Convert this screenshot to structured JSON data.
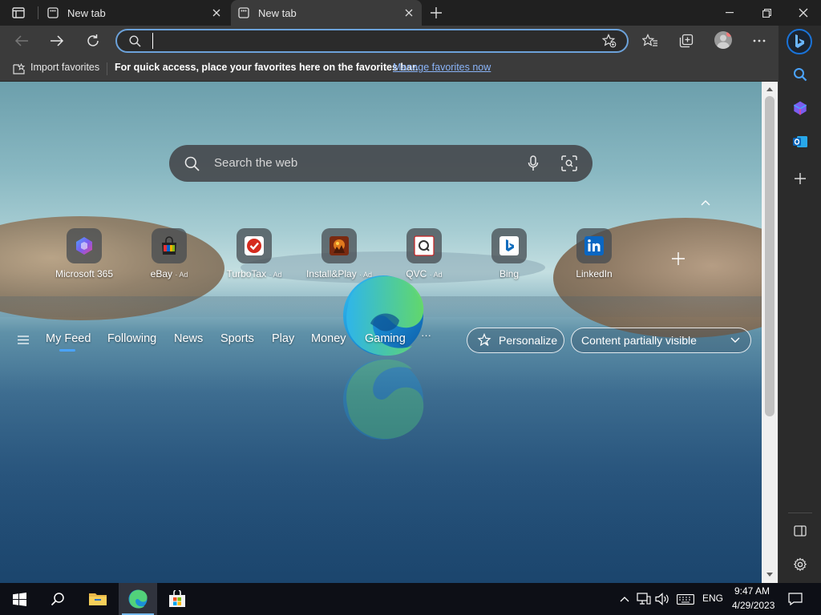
{
  "tabs": [
    {
      "title": "New tab",
      "active": false
    },
    {
      "title": "New tab",
      "active": true
    }
  ],
  "address": {
    "value": "",
    "placeholder": ""
  },
  "favorites_bar": {
    "import_label": "Import favorites",
    "message": "For quick access, place your favorites here on the favorites bar.",
    "manage_link": "Manage favorites now"
  },
  "search": {
    "placeholder": "Search the web"
  },
  "quick_links": [
    {
      "label": "Microsoft 365",
      "ad": "",
      "icon": "microsoft-365-icon"
    },
    {
      "label": "eBay",
      "ad": "· Ad",
      "icon": "ebay-icon"
    },
    {
      "label": "TurboTax",
      "ad": "· Ad",
      "icon": "turbotax-icon"
    },
    {
      "label": "Install&Play",
      "ad": "· Ad",
      "icon": "install-play-icon"
    },
    {
      "label": "QVC",
      "ad": "· Ad",
      "icon": "qvc-icon"
    },
    {
      "label": "Bing",
      "ad": "",
      "icon": "bing-icon"
    },
    {
      "label": "LinkedIn",
      "ad": "",
      "icon": "linkedin-icon"
    }
  ],
  "feed": {
    "tabs": [
      "My Feed",
      "Following",
      "News",
      "Sports",
      "Play",
      "Money",
      "Gaming"
    ],
    "more": "···",
    "personalize": "Personalize",
    "content_visibility": "Content partially visible"
  },
  "tray": {
    "language": "ENG",
    "time": "9:47 AM",
    "date": "4/29/2023"
  },
  "colors": {
    "accent": "#6ca2da",
    "link": "#8ab4f8",
    "taskbar": "#0d0f16"
  }
}
